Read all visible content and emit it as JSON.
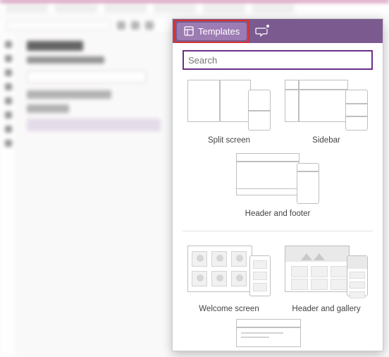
{
  "header": {
    "search_placeholder": "Search"
  },
  "tabs": {
    "templates": {
      "label": "Templates"
    }
  },
  "templates": [
    {
      "label": "Split screen"
    },
    {
      "label": "Sidebar"
    },
    {
      "label": "Header and footer"
    },
    {
      "label": "Welcome screen"
    },
    {
      "label": "Header and gallery"
    }
  ]
}
